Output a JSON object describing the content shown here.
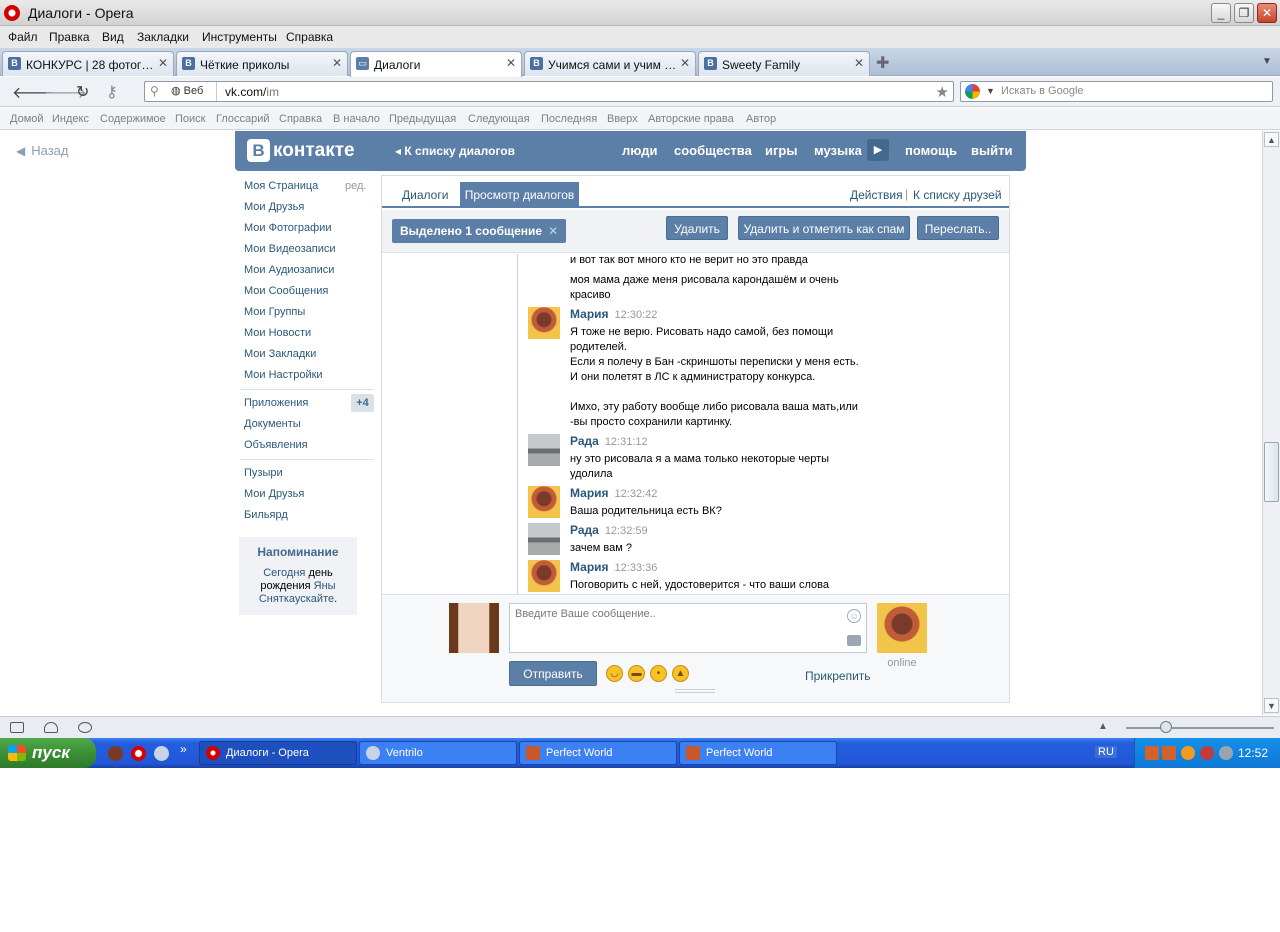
{
  "window": {
    "title": "Диалоги - Opera"
  },
  "menu": [
    "Файл",
    "Правка",
    "Вид",
    "Закладки",
    "Инструменты",
    "Справка"
  ],
  "tabs": [
    {
      "label": "КОНКУРС | 28 фотогра...",
      "active": false
    },
    {
      "label": "Чёткие приколы",
      "active": false
    },
    {
      "label": "Диалоги",
      "active": true
    },
    {
      "label": "Учимся сами и учим дет...",
      "active": false
    },
    {
      "label": "Sweety Family",
      "active": false
    }
  ],
  "address": {
    "site_label": "Веб",
    "url_host": "vk.com/",
    "url_path": "im"
  },
  "search": {
    "placeholder": "Искать в Google"
  },
  "nav_links": [
    "Домой",
    "Индекс",
    "Содержимое",
    "Поиск",
    "Глоссарий",
    "Справка",
    "В начало",
    "Предыдущая",
    "Следующая",
    "Последняя",
    "Вверх",
    "Авторские права",
    "Автор"
  ],
  "page": {
    "back_label": "Назад",
    "logo_letter": "B",
    "logo_word": "контакте",
    "header_back": "К списку диалогов",
    "header_nav": [
      "люди",
      "сообщества",
      "игры",
      "музыка",
      "помощь",
      "выйти"
    ],
    "left_menu_edit": "ред.",
    "left_menu": [
      "Моя Страница",
      "Мои Друзья",
      "Мои Фотографии",
      "Мои Видеозаписи",
      "Мои Аудиозаписи",
      "Мои Сообщения",
      "Мои Группы",
      "Мои Новости",
      "Мои Закладки",
      "Мои Настройки"
    ],
    "left_menu_2": [
      "Приложения",
      "Документы",
      "Объявления"
    ],
    "apps_badge": "+4",
    "left_menu_3": [
      "Пузыри",
      "Мои Друзья",
      "Бильярд"
    ],
    "reminder": {
      "title": "Напоминание",
      "today": "Сегодня",
      "text_mid": "день рождения",
      "name": "Яны Сняткаускайте",
      "end": "."
    },
    "dialog_tabs": {
      "dialogs": "Диалоги",
      "view": "Просмотр диалогов",
      "actions": "Действия",
      "sep": "|",
      "friends": "К списку друзей"
    },
    "toolbar": {
      "selected": "Выделено 1 сообщение",
      "close": "✕",
      "delete": "Удалить",
      "delete_spam": "Удалить и отметить как спам",
      "forward": "Переслать.."
    },
    "messages": {
      "m0": [
        "и вот так вот много кто не верит но это правда",
        "моя мама даже меня рисовала карондашём и очень",
        "красиво"
      ],
      "m1": {
        "author": "Мария",
        "time": "12:30:22",
        "lines": [
          "Я тоже не верю. Рисовать надо самой, без помощи",
          "родителей.",
          "Если я полечу в Бан -скриншоты переписки у меня есть.",
          "И они полетят в ЛС к администратору конкурса.",
          "Имхо, эту работу вообще либо рисовала ваша мать,или",
          "-вы просто сохранили картинку."
        ]
      },
      "m2": {
        "author": "Рада",
        "time": "12:31:12",
        "lines": [
          "ну это рисовала я а мама только некоторые черты",
          "удолила"
        ]
      },
      "m3": {
        "author": "Мария",
        "time": "12:32:42",
        "lines": [
          "Ваша родительница есть ВК?"
        ]
      },
      "m4": {
        "author": "Рада",
        "time": "12:32:59",
        "lines": [
          "зачем вам ?"
        ]
      },
      "m5": {
        "author": "Мария",
        "time": "12:33:36",
        "lines": [
          "Поговорить с ней, удостоверится - что ваши слова"
        ]
      }
    },
    "composer": {
      "placeholder": "Введите Ваше сообщение..",
      "send": "Отправить",
      "attach": "Прикрепить",
      "online": "online"
    }
  },
  "taskbar": {
    "start": "пуск",
    "tasks": [
      "Диалоги - Opera",
      "Ventrilo",
      "Perfect World",
      "Perfect World"
    ],
    "lang": "RU",
    "clock": "12:52"
  },
  "colors": {
    "vk_blue": "#5b7fa6",
    "vk_link": "#2b587a",
    "xp_blue": "#245edc",
    "xp_green": "#3c8f36"
  }
}
